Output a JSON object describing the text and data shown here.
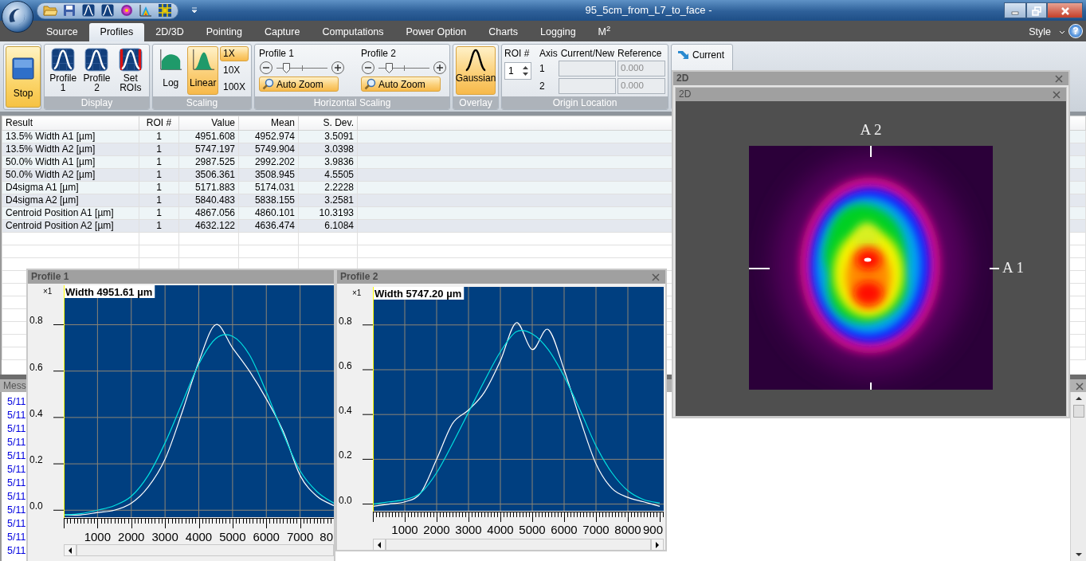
{
  "window": {
    "title": "95_5cm_from_L7_to_face -"
  },
  "tabs": [
    {
      "label": "Source",
      "selected": false
    },
    {
      "label": "Profiles",
      "selected": true
    },
    {
      "label": "2D/3D",
      "selected": false
    },
    {
      "label": "Pointing",
      "selected": false
    },
    {
      "label": "Capture",
      "selected": false
    },
    {
      "label": "Computations",
      "selected": false
    },
    {
      "label": "Power Option",
      "selected": false
    },
    {
      "label": "Charts",
      "selected": false
    },
    {
      "label": "Logging",
      "selected": false
    },
    {
      "label": "M$^{2}$",
      "selected": false
    }
  ],
  "style_menu": {
    "label": "Style"
  },
  "help_button": {
    "label": "?"
  },
  "ribbon": {
    "stop_button": {
      "label": "Stop",
      "active": true
    },
    "display": {
      "title": "Display",
      "buttons": [
        {
          "label": "Profile 1",
          "kind": "profile",
          "selected": false
        },
        {
          "label": "Profile 2",
          "kind": "profile",
          "selected": false
        },
        {
          "label": "Set ROIs",
          "kind": "roi",
          "selected": false
        }
      ]
    },
    "scaling": {
      "title": "Scaling",
      "modes": [
        {
          "label": "Log",
          "kind": "log",
          "selected": false
        },
        {
          "label": "Linear",
          "kind": "linear",
          "selected": true
        }
      ],
      "zoom_levels": [
        {
          "label": "1X",
          "selected": true
        },
        {
          "label": "10X",
          "selected": false
        },
        {
          "label": "100X",
          "selected": false
        }
      ]
    },
    "horizontal_scaling": {
      "title": "Horizontal Scaling",
      "profiles": [
        {
          "label": "Profile 1",
          "level": 0.18,
          "auto_zoom": {
            "label": "Auto Zoom",
            "selected": true
          }
        },
        {
          "label": "Profile 2",
          "level": 0.2,
          "auto_zoom": {
            "label": "Auto Zoom",
            "selected": true
          }
        }
      ]
    },
    "overlay": {
      "title": "Overlay",
      "button": {
        "label": "Gaussian",
        "selected": true
      }
    },
    "origin_location": {
      "title": "Origin Location",
      "roi_label": "ROI #",
      "roi_value": "1",
      "columns": [
        "Axis",
        "Current/New",
        "Reference"
      ],
      "rows": [
        {
          "axis": "1",
          "reference": "0.000"
        },
        {
          "axis": "2",
          "reference": "0.000"
        }
      ]
    },
    "current_button": {
      "label": "Current"
    }
  },
  "results_table": {
    "columns": [
      "Result",
      "ROI #",
      "Value",
      "Mean",
      "S. Dev."
    ],
    "rows": [
      [
        "13.5% Width A1 [µm]",
        "1",
        "4951.608",
        "4952.974",
        "3.5091"
      ],
      [
        "13.5% Width A2 [µm]",
        "1",
        "5747.197",
        "5749.904",
        "3.0398"
      ],
      [
        "50.0% Width A1 [µm]",
        "1",
        "2987.525",
        "2992.202",
        "3.9836"
      ],
      [
        "50.0% Width A2 [µm]",
        "1",
        "3506.361",
        "3508.945",
        "4.5505"
      ],
      [
        "D4sigma A1 [µm]",
        "1",
        "5171.883",
        "5174.031",
        "2.2228"
      ],
      [
        "D4sigma A2 [µm]",
        "1",
        "5840.483",
        "5838.155",
        "3.2581"
      ],
      [
        "Centroid Position A1 [µm]",
        "1",
        "4867.056",
        "4860.101",
        "10.3193"
      ],
      [
        "Centroid Position A2 [µm]",
        "1",
        "4632.122",
        "4636.474",
        "6.1084"
      ]
    ]
  },
  "messages": {
    "title": "Mess",
    "lines": [
      "5/11",
      "5/11",
      "5/11",
      "5/11",
      "5/11",
      "5/11",
      "5/11",
      "5/11",
      "5/11",
      "5/11",
      "5/11",
      "5/11"
    ]
  },
  "profile_windows": [
    {
      "title": "Profile 1",
      "close_button": false,
      "scale_label": "×1",
      "edge_label": "80",
      "chart_data": {
        "type": "line",
        "title": "Width 4951.61 µm",
        "x": [
          0,
          500,
          1000,
          1500,
          2000,
          2500,
          3000,
          3500,
          4000,
          4500,
          5000,
          5500,
          6000,
          6500,
          7000,
          7500,
          8000
        ],
        "series": [
          {
            "color": "#ffffff",
            "values": [
              -0.02,
              -0.02,
              -0.01,
              0.0,
              0.03,
              0.1,
              0.22,
              0.42,
              0.64,
              0.8,
              0.7,
              0.6,
              0.48,
              0.34,
              0.15,
              0.06,
              0.02
            ]
          },
          {
            "color": "#00e0e0",
            "values": [
              -0.02,
              -0.015,
              0.0,
              0.02,
              0.06,
              0.15,
              0.29,
              0.46,
              0.63,
              0.74,
              0.75,
              0.67,
              0.51,
              0.33,
              0.17,
              0.08,
              0.03
            ]
          }
        ],
        "grid": true,
        "xlim": [
          0,
          8000
        ],
        "ylim": [
          -0.03,
          0.97
        ],
        "xticks": [
          1000,
          2000,
          3000,
          4000,
          5000,
          6000,
          7000
        ],
        "yticks": [
          {
            "value": 0,
            "label": "0.0"
          },
          {
            "value": 0.2,
            "label": "0.2"
          },
          {
            "value": 0.4,
            "label": "0.4"
          },
          {
            "value": 0.6,
            "label": "0.6"
          },
          {
            "value": 0.8,
            "label": "0.8"
          }
        ]
      }
    },
    {
      "title": "Profile 2",
      "close_button": true,
      "scale_label": "×1",
      "edge_label": "900",
      "chart_data": {
        "type": "line",
        "title": "Width 5747.20 µm",
        "x": [
          0,
          500,
          1000,
          1500,
          2000,
          2500,
          3000,
          3500,
          4000,
          4500,
          5000,
          5500,
          6000,
          6500,
          7000,
          7500,
          8000,
          8500,
          9000
        ],
        "series": [
          {
            "color": "#ffffff",
            "values": [
              -0.01,
              0.0,
              0.01,
              0.05,
              0.2,
              0.36,
              0.42,
              0.5,
              0.64,
              0.81,
              0.69,
              0.78,
              0.6,
              0.38,
              0.18,
              0.07,
              0.03,
              0.01,
              -0.01
            ]
          },
          {
            "color": "#00e0e0",
            "values": [
              0.0,
              0.01,
              0.02,
              0.05,
              0.14,
              0.27,
              0.41,
              0.55,
              0.68,
              0.77,
              0.76,
              0.69,
              0.57,
              0.42,
              0.26,
              0.14,
              0.06,
              0.02,
              0.005
            ]
          }
        ],
        "grid": true,
        "xlim": [
          0,
          9125
        ],
        "ylim": [
          -0.03,
          0.97
        ],
        "xticks": [
          1000,
          2000,
          3000,
          4000,
          5000,
          6000,
          7000,
          8000
        ],
        "yticks": [
          {
            "value": 0,
            "label": "0.0"
          },
          {
            "value": 0.2,
            "label": "0.2"
          },
          {
            "value": 0.4,
            "label": "0.4"
          },
          {
            "value": 0.6,
            "label": "0.6"
          },
          {
            "value": 0.8,
            "label": "0.8"
          }
        ]
      }
    }
  ],
  "image_windows": [
    {
      "title": "2D",
      "close_button": true
    },
    {
      "title": "2D",
      "close_button": true,
      "axis_labels": [
        "A 2",
        "A 1"
      ]
    }
  ]
}
